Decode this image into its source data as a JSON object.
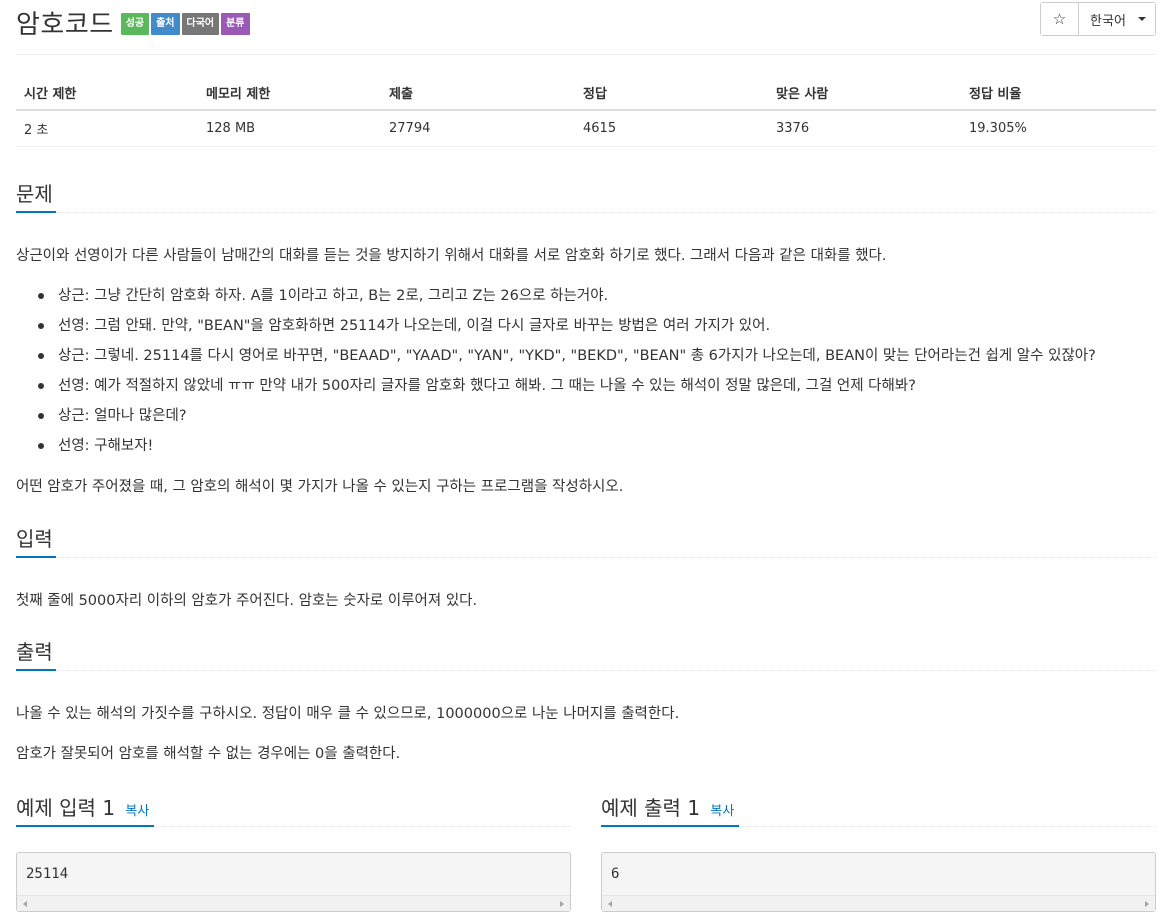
{
  "problem": {
    "title": "암호코드",
    "badges": [
      {
        "label": "성공",
        "color": "#5cb85c"
      },
      {
        "label": "출처",
        "color": "#428bca"
      },
      {
        "label": "다국어",
        "color": "#777777"
      },
      {
        "label": "분류",
        "color": "#9b59b6"
      }
    ]
  },
  "toolbar": {
    "star_icon": "☆",
    "language": "한국어"
  },
  "info_table": {
    "headers": [
      "시간 제한",
      "메모리 제한",
      "제출",
      "정답",
      "맞은 사람",
      "정답 비율"
    ],
    "values": [
      "2 초",
      "128 MB",
      "27794",
      "4615",
      "3376",
      "19.305%"
    ]
  },
  "sections": {
    "problem_heading": "문제",
    "intro": "상근이와 선영이가 다른 사람들이 남매간의 대화를 듣는 것을 방지하기 위해서 대화를 서로 암호화 하기로 했다. 그래서 다음과 같은 대화를 했다.",
    "dialog": [
      "상근: 그냥 간단히 암호화 하자. A를 1이라고 하고, B는 2로, 그리고 Z는 26으로 하는거야.",
      "선영: 그럼 안돼. 만약, \"BEAN\"을 암호화하면 25114가 나오는데, 이걸 다시 글자로 바꾸는 방법은 여러 가지가 있어.",
      "상근: 그렇네. 25114를 다시 영어로 바꾸면, \"BEAAD\", \"YAAD\", \"YAN\", \"YKD\", \"BEKD\", \"BEAN\" 총 6가지가 나오는데, BEAN이 맞는 단어라는건 쉽게 알수 있잖아?",
      "선영: 예가 적절하지 않았네 ㅠㅠ 만약 내가 500자리 글자를 암호화 했다고 해봐. 그 때는 나올 수 있는 해석이 정말 많은데, 그걸 언제 다해봐?",
      "상근: 얼마나 많은데?",
      "선영: 구해보자!"
    ],
    "task": "어떤 암호가 주어졌을 때, 그 암호의 해석이 몇 가지가 나올 수 있는지 구하는 프로그램을 작성하시오.",
    "input_heading": "입력",
    "input_text": "첫째 줄에 5000자리 이하의 암호가 주어진다. 암호는 숫자로 이루어져 있다.",
    "output_heading": "출력",
    "output_text1": "나올 수 있는 해석의 가짓수를 구하시오. 정답이 매우 클 수 있으므로, 1000000으로 나눈 나머지를 출력한다.",
    "output_text2": "암호가 잘못되어 암호를 해석할 수 없는 경우에는 0을 출력한다."
  },
  "examples": {
    "input_title": "예제 입력 1",
    "output_title": "예제 출력 1",
    "copy_label": "복사",
    "input_value": "25114",
    "output_value": "6"
  }
}
